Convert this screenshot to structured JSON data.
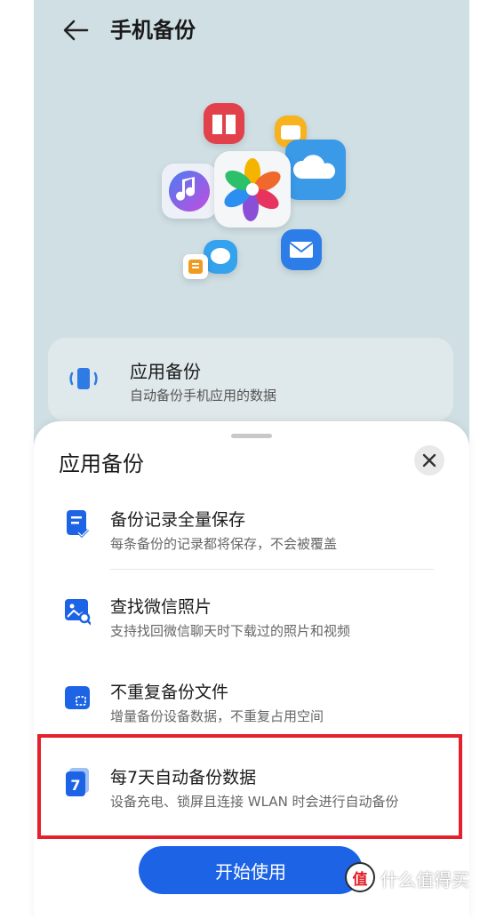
{
  "header": {
    "title": "手机备份"
  },
  "card": {
    "title": "应用备份",
    "subtitle": "自动备份手机应用的数据"
  },
  "sheet": {
    "title": "应用备份",
    "features": [
      {
        "title": "备份记录全量保存",
        "desc": "每条备份的记录都将保存，不会被覆盖"
      },
      {
        "title": "查找微信照片",
        "desc": "支持找回微信聊天时下载过的照片和视频"
      },
      {
        "title": "不重复备份文件",
        "desc": "增量备份设备数据，不重复占用空间"
      },
      {
        "title": "每7天自动备份数据",
        "desc": "设备充电、锁屏且连接 WLAN 时会进行自动备份"
      }
    ],
    "feature4_icon_digit": "7",
    "start_label": "开始使用"
  },
  "watermark": {
    "logo": "值",
    "text": "什么值得买"
  },
  "colors": {
    "accent": "#1d63e6",
    "highlight": "#e5202a"
  }
}
